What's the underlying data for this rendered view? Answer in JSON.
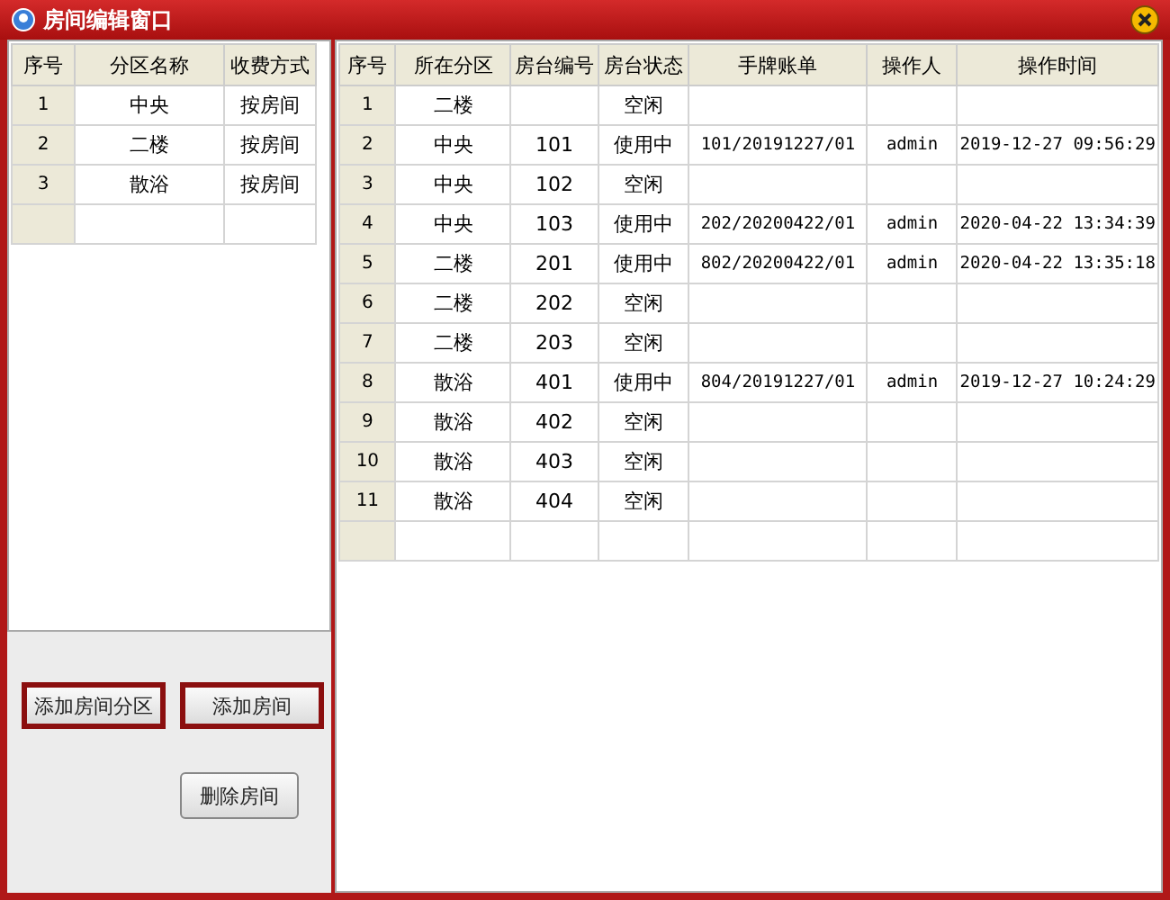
{
  "window": {
    "title": "房间编辑窗口"
  },
  "zones_table": {
    "columns": [
      "序号",
      "分区名称",
      "收费方式"
    ],
    "rows": [
      [
        "1",
        "中央",
        "按房间"
      ],
      [
        "2",
        "二楼",
        "按房间"
      ],
      [
        "3",
        "散浴",
        "按房间"
      ]
    ]
  },
  "buttons": [
    {
      "label": "添加房间分区",
      "highlighted": true
    },
    {
      "label": "添加房间",
      "highlighted": true
    },
    {
      "label": "删除房间",
      "highlighted": false
    }
  ],
  "rooms_table": {
    "columns": [
      "序号",
      "所在分区",
      "房台编号",
      "房台状态",
      "手牌账单",
      "操作人",
      "操作时间"
    ],
    "rows": [
      [
        "1",
        "二楼",
        "",
        "空闲",
        "",
        "",
        ""
      ],
      [
        "2",
        "中央",
        "101",
        "使用中",
        "101/20191227/01",
        "admin",
        "2019-12-27 09:56:29"
      ],
      [
        "3",
        "中央",
        "102",
        "空闲",
        "",
        "",
        ""
      ],
      [
        "4",
        "中央",
        "103",
        "使用中",
        "202/20200422/01",
        "admin",
        "2020-04-22 13:34:39"
      ],
      [
        "5",
        "二楼",
        "201",
        "使用中",
        "802/20200422/01",
        "admin",
        "2020-04-22 13:35:18"
      ],
      [
        "6",
        "二楼",
        "202",
        "空闲",
        "",
        "",
        ""
      ],
      [
        "7",
        "二楼",
        "203",
        "空闲",
        "",
        "",
        ""
      ],
      [
        "8",
        "散浴",
        "401",
        "使用中",
        "804/20191227/01",
        "admin",
        "2019-12-27 10:24:29"
      ],
      [
        "9",
        "散浴",
        "402",
        "空闲",
        "",
        "",
        ""
      ],
      [
        "10",
        "散浴",
        "403",
        "空闲",
        "",
        "",
        ""
      ],
      [
        "11",
        "散浴",
        "404",
        "空闲",
        "",
        "",
        ""
      ]
    ]
  }
}
